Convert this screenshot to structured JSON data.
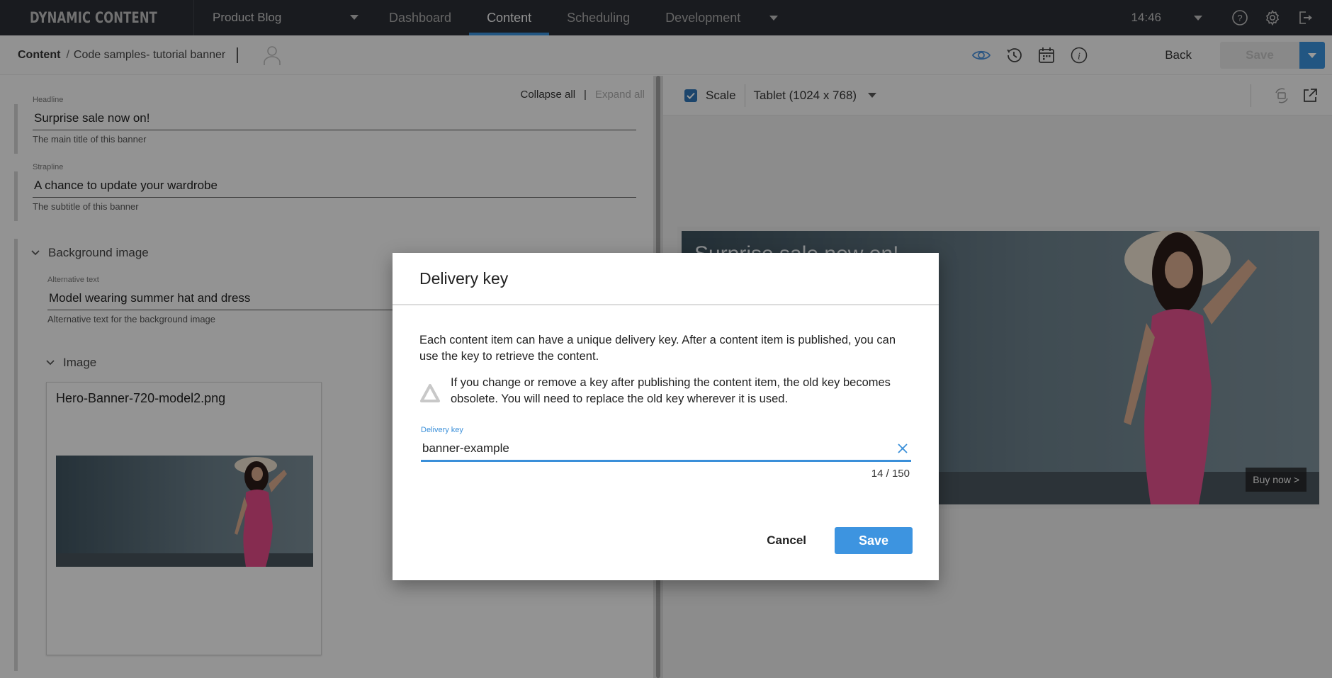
{
  "app": {
    "logo_text": "DYNAMIC CONTENT",
    "hub_name": "Product Blog",
    "nav_tabs": [
      {
        "label": "Dashboard",
        "active": false
      },
      {
        "label": "Content",
        "active": true
      },
      {
        "label": "Scheduling",
        "active": false
      },
      {
        "label": "Development",
        "active": false
      }
    ],
    "clock": "14:46",
    "icons": [
      "help-icon",
      "settings-icon",
      "logout-icon"
    ],
    "accent_color": "#3a8fd9"
  },
  "subbar": {
    "breadcrumb_root": "Content",
    "breadcrumb_separator": "/",
    "breadcrumb_item": "Code samples- tutorial banner",
    "icons": [
      "preview-eye-icon",
      "history-icon",
      "calendar-icon",
      "info-icon"
    ],
    "back_label": "Back",
    "save_label": "Save"
  },
  "editor": {
    "collapse_all": "Collapse all",
    "separator": "|",
    "expand_all": "Expand all",
    "headline": {
      "label": "Headline",
      "value": "Surprise sale now on!",
      "help": "The main title of this banner"
    },
    "strapline": {
      "label": "Strapline",
      "value": "A chance to update your wardrobe",
      "help": "The subtitle of this banner"
    },
    "background_image": {
      "section_label": "Background image",
      "alt_text": {
        "label": "Alternative text",
        "value": "Model wearing summer hat and dress",
        "help": "Alternative text for the background image"
      },
      "image_section_label": "Image",
      "image_filename": "Hero-Banner-720-model2.png"
    }
  },
  "preview": {
    "scale_label": "Scale",
    "scale_checked": true,
    "device": "Tablet (1024 x 768)",
    "banner_headline": "Surprise sale now on!",
    "buy_now": "Buy now >"
  },
  "modal": {
    "title": "Delivery key",
    "description": "Each content item can have a unique delivery key. After a content item is published, you can use the key to retrieve the content.",
    "warning": "If you change or remove a key after publishing the content item, the old key becomes obsolete. You will need to replace the old key wherever it is used.",
    "field_label": "Delivery key",
    "field_value": "banner-example",
    "char_count": "14 / 150",
    "cancel_label": "Cancel",
    "save_label": "Save"
  }
}
